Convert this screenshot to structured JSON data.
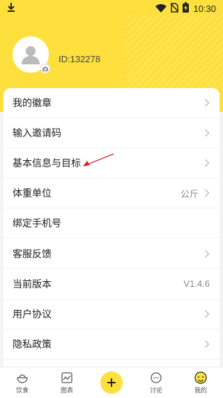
{
  "status": {
    "time": "10:30"
  },
  "profile": {
    "id_text": "ID:132278"
  },
  "menu": [
    {
      "label": "我的徽章",
      "value": ""
    },
    {
      "label": "输入邀请码",
      "value": ""
    },
    {
      "label": "基本信息与目标",
      "value": ""
    },
    {
      "label": "体重单位",
      "value": "公斤"
    },
    {
      "label": "绑定手机号",
      "value": ""
    },
    {
      "label": "客服反馈",
      "value": ""
    },
    {
      "label": "当前版本",
      "value": "V1.4.6"
    },
    {
      "label": "用户协议",
      "value": ""
    },
    {
      "label": "隐私政策",
      "value": ""
    }
  ],
  "tabs": [
    {
      "label": "饮食",
      "icon": "bowl-icon"
    },
    {
      "label": "图表",
      "icon": "chart-icon"
    },
    {
      "label": "",
      "icon": "plus-icon"
    },
    {
      "label": "讨论",
      "icon": "chat-icon"
    },
    {
      "label": "我的",
      "icon": "smiley-icon"
    }
  ],
  "colors": {
    "accent": "#fde03e",
    "arrow": "#e02020"
  }
}
